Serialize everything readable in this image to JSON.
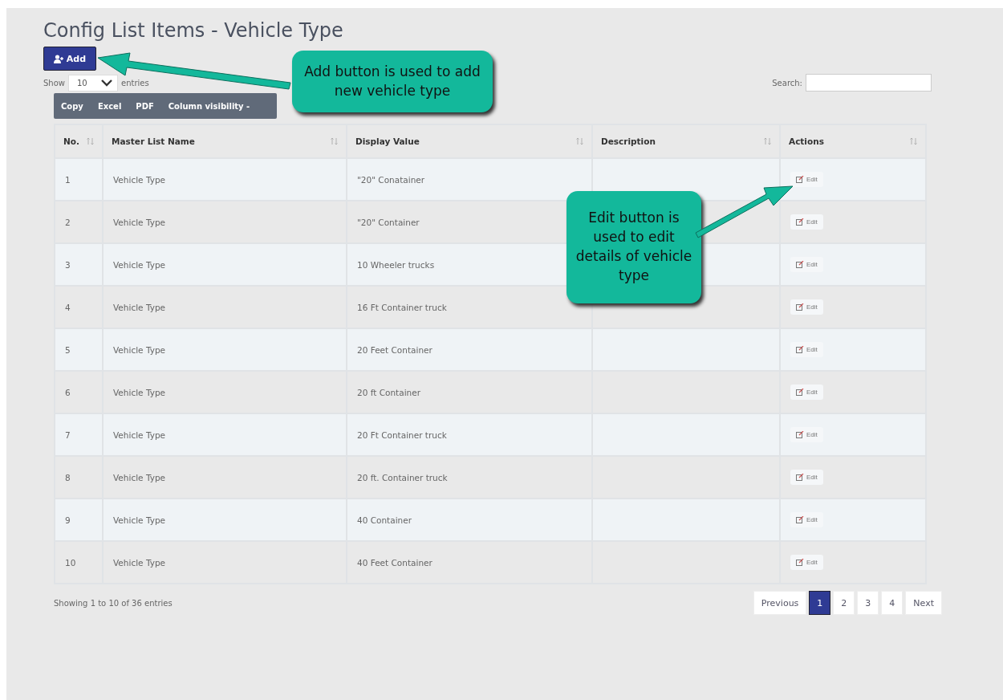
{
  "title": "Config List Items - Vehicle Type",
  "add_button": {
    "label": "Add"
  },
  "length_menu": {
    "before": "Show",
    "value": "10",
    "after": "entries"
  },
  "search": {
    "label": "Search:"
  },
  "export_buttons": [
    "Copy",
    "Excel",
    "PDF",
    "Column visibility -"
  ],
  "table": {
    "columns": [
      "No.",
      "Master List Name",
      "Display Value",
      "Description",
      "Actions"
    ],
    "rows": [
      {
        "no": "1",
        "master": "Vehicle Type",
        "display": "\"20\" Conatainer",
        "action": "Edit"
      },
      {
        "no": "2",
        "master": "Vehicle Type",
        "display": "\"20\" Container",
        "action": "Edit"
      },
      {
        "no": "3",
        "master": "Vehicle Type",
        "display": "10 Wheeler trucks",
        "action": "Edit"
      },
      {
        "no": "4",
        "master": "Vehicle Type",
        "display": "16 Ft Container truck",
        "action": "Edit"
      },
      {
        "no": "5",
        "master": "Vehicle Type",
        "display": "20 Feet Container",
        "action": "Edit"
      },
      {
        "no": "6",
        "master": "Vehicle Type",
        "display": "20 ft Container",
        "action": "Edit"
      },
      {
        "no": "7",
        "master": "Vehicle Type",
        "display": "20 Ft Container truck",
        "action": "Edit"
      },
      {
        "no": "8",
        "master": "Vehicle Type",
        "display": "20 ft. Container truck",
        "action": "Edit"
      },
      {
        "no": "9",
        "master": "Vehicle Type",
        "display": "40 Container",
        "action": "Edit"
      },
      {
        "no": "10",
        "master": "Vehicle Type",
        "display": "40 Feet Container",
        "action": "Edit"
      }
    ]
  },
  "info": "Showing 1 to 10 of 36 entries",
  "pagination": [
    {
      "label": "Previous",
      "selected": false
    },
    {
      "label": "1",
      "selected": true
    },
    {
      "label": "2",
      "selected": false
    },
    {
      "label": "3",
      "selected": false
    },
    {
      "label": "4",
      "selected": false
    },
    {
      "label": "Next",
      "selected": false
    }
  ],
  "callouts": [
    {
      "text": "Add button is used to add new vehicle type"
    },
    {
      "text": "Edit button is used to edit details of vehicle type"
    }
  ]
}
